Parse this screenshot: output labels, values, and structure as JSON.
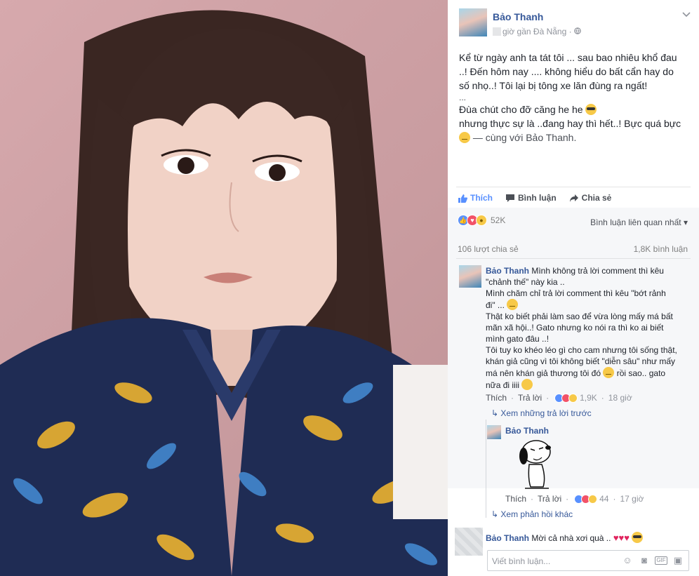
{
  "post": {
    "author": "Bảo Thanh",
    "time_location": "giờ gần Đà Nẵng ·",
    "text_lines": [
      "Kể từ ngày anh ta tát tôi ... sau bao nhiêu khổ đau",
      "..! Đến hôm nay .... không hiểu do bất cẩn hay do",
      "số nhọ..! Tôi lại bị tông xe lăn đùng ra ngất!"
    ],
    "ellipsis": "...",
    "joke_line": "Đùa chút cho đỡ căng he he",
    "line_cont": "nhưng thực sự là ..đang hay thì hết..! Bực quá bực",
    "with_text": "— cùng với Bảo Thanh."
  },
  "actions": {
    "like": "Thích",
    "comment": "Bình luận",
    "share": "Chia sẻ"
  },
  "stats": {
    "reactions_count": "52K",
    "sort_label": "Bình luận liên quan nhất",
    "shares": "106 lượt chia sẻ",
    "comments": "1,8K bình luận"
  },
  "comment1": {
    "name": "Bảo Thanh",
    "text_first": "Mình không trả lời comment thì kêu",
    "lines": [
      "\"chảnh thế\" này kia ..",
      "Mình chăm chỉ trả lời comment thì kêu \"bớt rảnh",
      "đi\" ...",
      "Thật ko biết phải làm sao để vừa lòng mấy má bất",
      "mãn xã hội..! Gato nhưng ko nói ra thì ko ai biết",
      "mình gato đâu ..!",
      "Tôi tuy ko khéo léo gì cho cam nhưng tôi sống thật,",
      "khán giả cũng vì tôi không biết \"diễn sâu\" như mấy",
      "má nên khán giả thương tôi đó",
      "nữa đi iiii"
    ],
    "after_smile": "rồi sao.. gato",
    "like": "Thích",
    "reply": "Trả lời",
    "reactions": "1,9K",
    "time": "18 giờ"
  },
  "view_previous": "Xem những trả lời trước",
  "reply1": {
    "name": "Bảo Thanh",
    "like": "Thích",
    "reply": "Trả lời",
    "reactions": "44",
    "time": "17 giờ"
  },
  "view_more": "Xem phản hồi khác",
  "comment2": {
    "name": "Bảo Thanh",
    "text": "Mời cả nhà xơi quà ..",
    "hearts": "♥♥♥"
  },
  "composer": {
    "placeholder": "Viết bình luận..."
  },
  "colors": {
    "link": "#365899",
    "like_blue": "#5890ff",
    "love_red": "#f25268"
  }
}
